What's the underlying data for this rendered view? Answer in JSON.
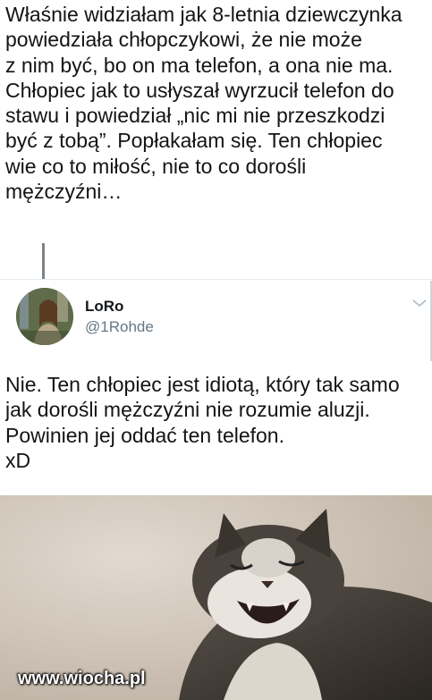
{
  "original_tweet": {
    "lines": [
      "Właśnie widziałam jak 8-letnia dziewczynka",
      "powiedziała chłopczykowi, że nie może",
      "z nim być, bo on ma telefon, a ona nie ma.",
      "Chłopiec jak to usłyszał wyrzucił telefon do",
      "stawu i powiedział „nic mi nie przeszkodzi",
      "być z tobą”. Popłakałam się. Ten chłopiec",
      "wie co to miłość, nie to co dorośli",
      "mężczyźni…"
    ]
  },
  "reply": {
    "display_name": "LoRo",
    "handle": "@1Rohde",
    "avatar_icon": "user-avatar-photo",
    "menu_icon": "chevron-down-icon",
    "lines": [
      "Nie. Ten chłopiec jest idiotą, który tak samo",
      "jak dorośli mężczyźni nie rozumie aluzji.",
      "Powinien jej oddać ten telefon.",
      "xD"
    ]
  },
  "image": {
    "watermark": "www.wiocha.pl"
  },
  "colors": {
    "text": "#141414",
    "handle": "#657786",
    "thread_line": "#7d8288"
  }
}
